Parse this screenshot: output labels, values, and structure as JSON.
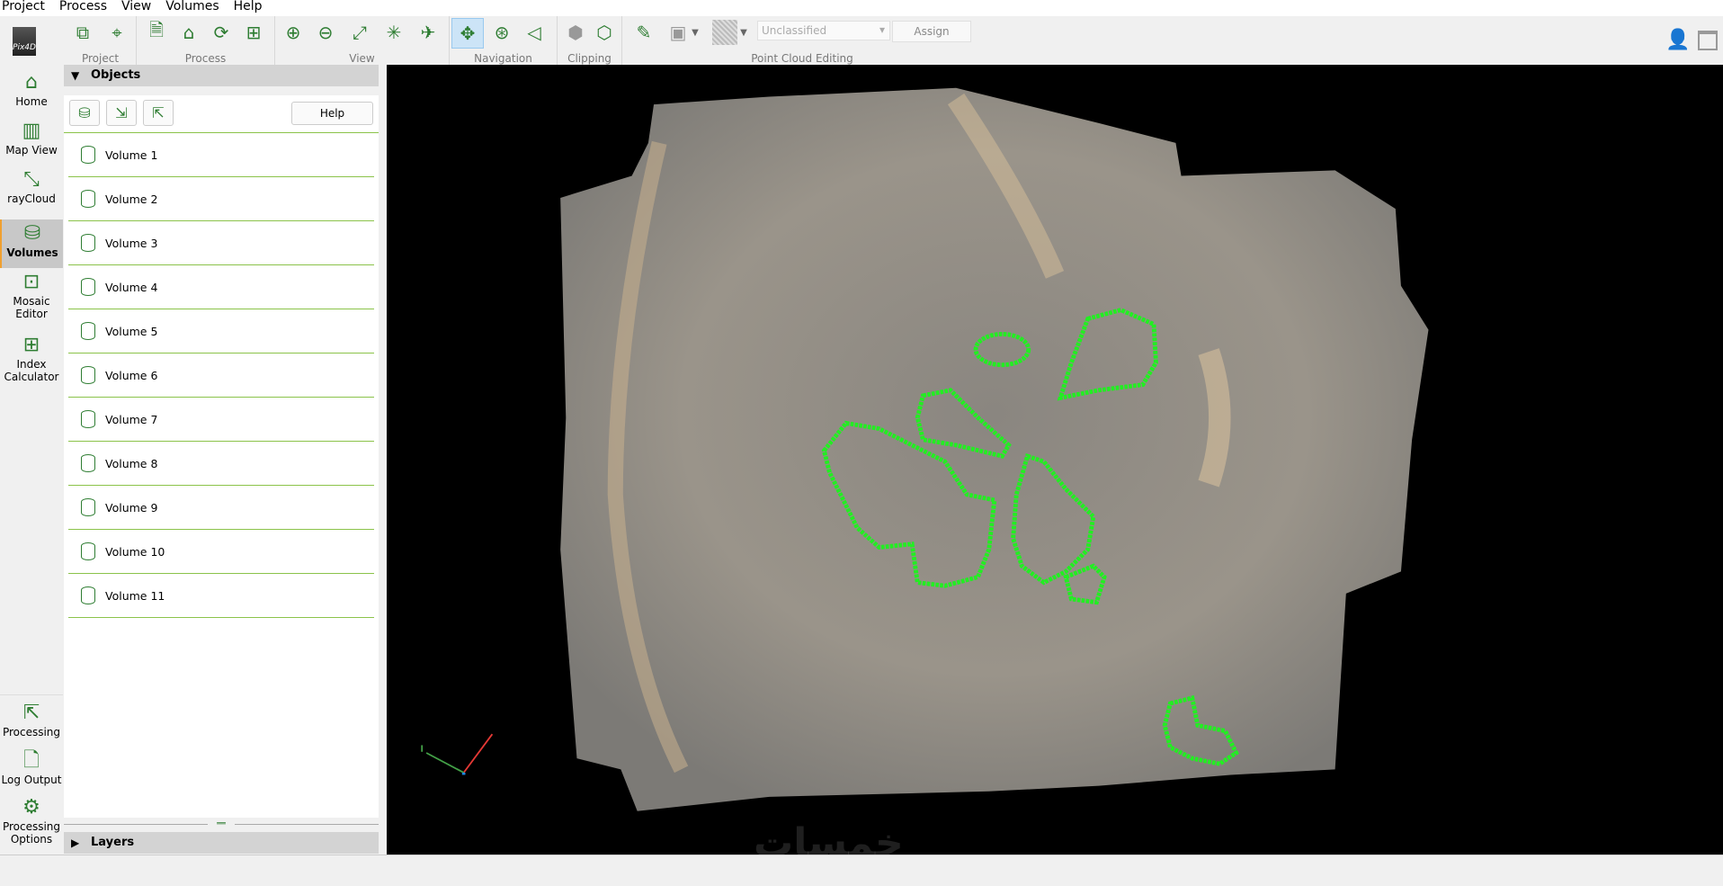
{
  "menu": [
    "Project",
    "Process",
    "View",
    "Volumes",
    "Help"
  ],
  "logo_text": "Pix4D",
  "toolbar": {
    "groups": [
      {
        "label": "Project",
        "icons": [
          "camera-stack-icon",
          "gcp-target-icon"
        ]
      },
      {
        "label": "Process",
        "icons": [
          "new-project-icon",
          "open-folder-icon",
          "rerun-icon",
          "add-step-icon"
        ]
      },
      {
        "label": "View",
        "icons": [
          "zoom-in-icon",
          "zoom-out-icon",
          "fit-all-icon",
          "collapse-icon",
          "fly-icon"
        ]
      },
      {
        "label": "Navigation",
        "icons": [
          "trackball-icon",
          "orbit-icon",
          "perspective-icon"
        ]
      },
      {
        "label": "Clipping",
        "icons": [
          "clip-box-icon",
          "clip-edit-icon"
        ]
      },
      {
        "label": "Point Cloud Editing",
        "icons": [
          "brush-icon",
          "point-select-icon",
          "hatch-icon"
        ]
      }
    ],
    "class_select": "Unclassified",
    "assign_label": "Assign"
  },
  "nav": {
    "top": [
      {
        "label": "Home",
        "icon": "home-icon"
      },
      {
        "label": "Map View",
        "icon": "map-icon"
      },
      {
        "label": "rayCloud",
        "icon": "raycloud-icon"
      },
      {
        "label": "Volumes",
        "icon": "cylinder-icon",
        "active": true
      },
      {
        "label": "Mosaic Editor",
        "icon": "mosaic-icon"
      },
      {
        "label": "Index Calculator",
        "icon": "calculator-icon"
      }
    ],
    "bottom": [
      {
        "label": "Processing",
        "icon": "export-icon"
      },
      {
        "label": "Log Output",
        "icon": "log-icon"
      },
      {
        "label": "Processing Options",
        "icon": "gear-icon"
      }
    ]
  },
  "objects": {
    "title": "Objects",
    "help_label": "Help",
    "volumes": [
      "Volume 1",
      "Volume 2",
      "Volume 3",
      "Volume 4",
      "Volume 5",
      "Volume 6",
      "Volume 7",
      "Volume 8",
      "Volume 9",
      "Volume 10",
      "Volume 11"
    ]
  },
  "layers": {
    "title": "Layers"
  },
  "colors": {
    "accent": "#2e7d32",
    "divider": "#8bc34a",
    "volume_outline": "#22ee22",
    "viewport_bg": "#000000"
  },
  "watermark": "خمسات"
}
